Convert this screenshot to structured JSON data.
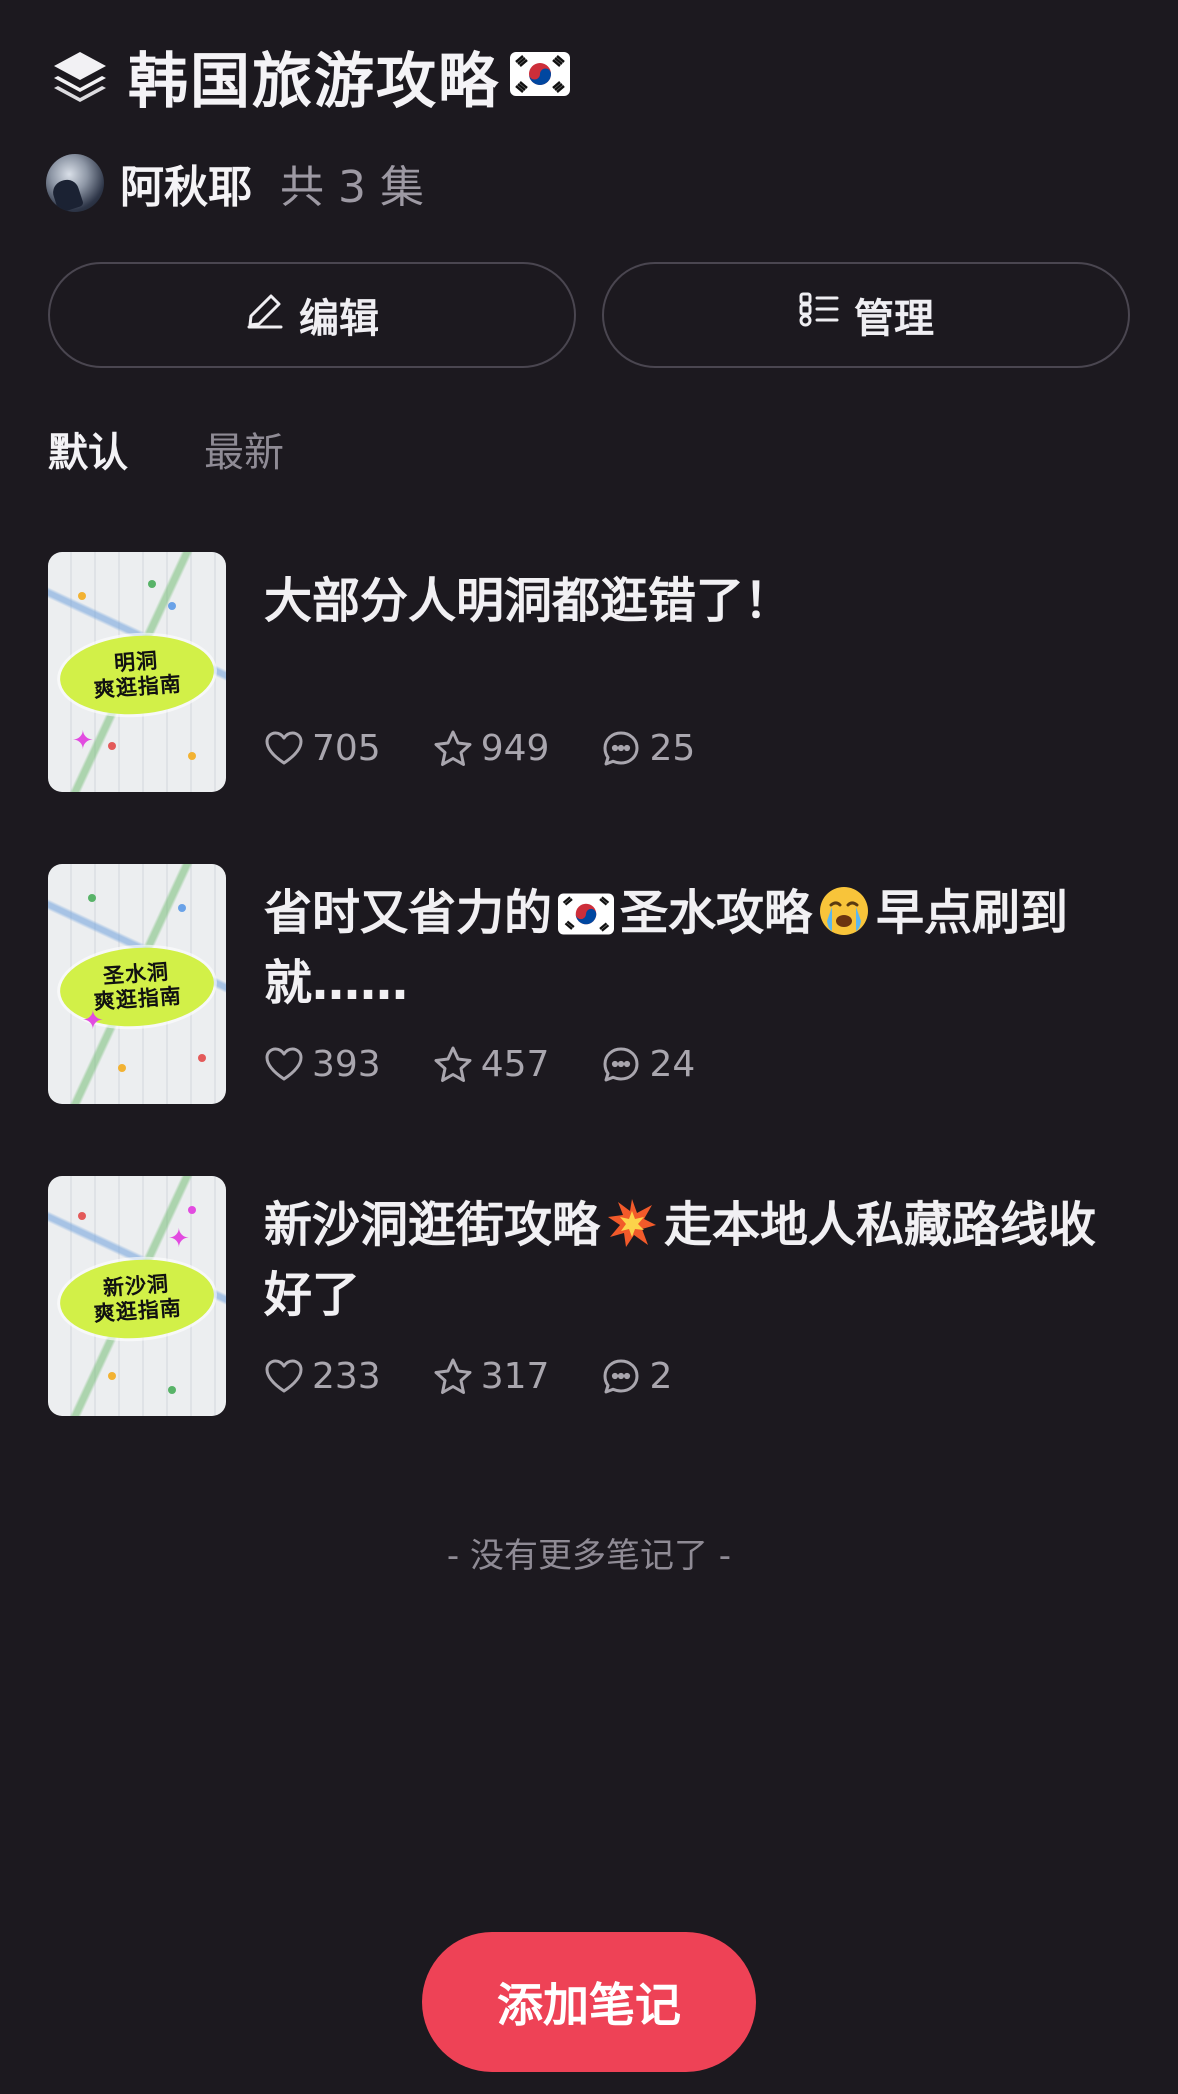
{
  "header": {
    "title": "韩国旅游攻略",
    "title_icon": "layers-icon",
    "title_flag": "south-korea-flag",
    "author_name": "阿秋耶",
    "episode_count": "共 3 集"
  },
  "actions": {
    "edit_label": "编辑",
    "manage_label": "管理"
  },
  "tabs": [
    {
      "label": "默认",
      "active": true
    },
    {
      "label": "最新",
      "active": false
    }
  ],
  "notes": [
    {
      "title": "大部分人明洞都逛错了！",
      "thumb_lines": [
        "明洞",
        "爽逛指南"
      ],
      "likes": "705",
      "stars": "949",
      "comments": "25"
    },
    {
      "title_parts": [
        "省时又省力的",
        "圣水攻略",
        "早点刷到就……"
      ],
      "thumb_lines": [
        "圣水洞",
        "爽逛指南"
      ],
      "likes": "393",
      "stars": "457",
      "comments": "24"
    },
    {
      "title_parts": [
        "新沙洞逛街攻略",
        "走本地人私藏路线收好了"
      ],
      "thumb_lines": [
        "新沙洞",
        "爽逛指南"
      ],
      "likes": "233",
      "stars": "317",
      "comments": "2"
    }
  ],
  "footer": {
    "no_more": "- 没有更多笔记了 -",
    "add_note": "添加笔记"
  },
  "colors": {
    "background": "#1c191f",
    "accent": "#ee4256",
    "thumb_highlight": "#d2f048"
  }
}
